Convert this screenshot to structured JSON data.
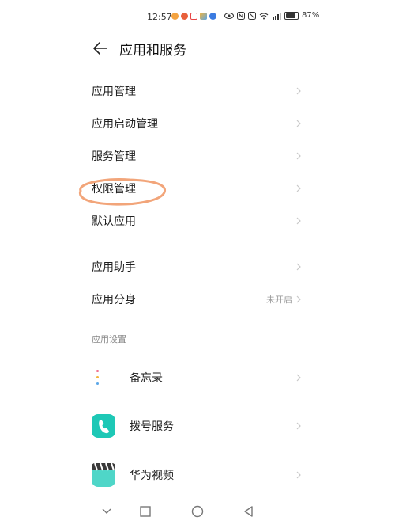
{
  "status_bar": {
    "time": "12:57",
    "battery_percent": "87%",
    "notification_icons": [
      "weibo-icon",
      "weibo-icon",
      "square-app-icon",
      "gallery-icon",
      "browser-icon"
    ],
    "system_icons": [
      "eye-icon",
      "nfc-icon",
      "mute-icon",
      "wifi-icon",
      "signal-icon",
      "battery-icon"
    ]
  },
  "header": {
    "title": "应用和服务"
  },
  "menu": {
    "group1": [
      {
        "label": "应用管理"
      },
      {
        "label": "应用启动管理"
      },
      {
        "label": "服务管理"
      },
      {
        "label": "权限管理"
      },
      {
        "label": "默认应用"
      }
    ],
    "group2": [
      {
        "label": "应用助手",
        "value": ""
      },
      {
        "label": "应用分身",
        "value": "未开启"
      }
    ]
  },
  "app_settings": {
    "section_title": "应用设置",
    "apps": [
      {
        "label": "备忘录",
        "icon": "notepad-icon"
      },
      {
        "label": "拨号服务",
        "icon": "phone-icon",
        "color": "#1ec8b6"
      },
      {
        "label": "华为视频",
        "icon": "video-icon",
        "color": "#4fd6c8"
      }
    ]
  },
  "annotation": {
    "color": "#f2a57a"
  },
  "nav_bar": {
    "buttons": [
      "collapse-icon",
      "recents-icon",
      "home-icon",
      "back-icon"
    ]
  }
}
